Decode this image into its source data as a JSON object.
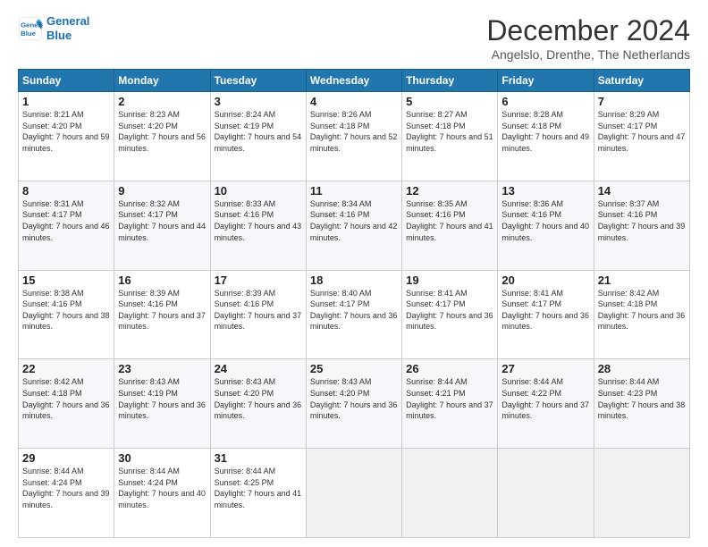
{
  "logo": {
    "line1": "General",
    "line2": "Blue"
  },
  "title": "December 2024",
  "location": "Angelslo, Drenthe, The Netherlands",
  "days_of_week": [
    "Sunday",
    "Monday",
    "Tuesday",
    "Wednesday",
    "Thursday",
    "Friday",
    "Saturday"
  ],
  "weeks": [
    [
      {
        "day": "1",
        "sunrise": "8:21 AM",
        "sunset": "4:20 PM",
        "daylight": "7 hours and 59 minutes."
      },
      {
        "day": "2",
        "sunrise": "8:23 AM",
        "sunset": "4:20 PM",
        "daylight": "7 hours and 56 minutes."
      },
      {
        "day": "3",
        "sunrise": "8:24 AM",
        "sunset": "4:19 PM",
        "daylight": "7 hours and 54 minutes."
      },
      {
        "day": "4",
        "sunrise": "8:26 AM",
        "sunset": "4:18 PM",
        "daylight": "7 hours and 52 minutes."
      },
      {
        "day": "5",
        "sunrise": "8:27 AM",
        "sunset": "4:18 PM",
        "daylight": "7 hours and 51 minutes."
      },
      {
        "day": "6",
        "sunrise": "8:28 AM",
        "sunset": "4:18 PM",
        "daylight": "7 hours and 49 minutes."
      },
      {
        "day": "7",
        "sunrise": "8:29 AM",
        "sunset": "4:17 PM",
        "daylight": "7 hours and 47 minutes."
      }
    ],
    [
      {
        "day": "8",
        "sunrise": "8:31 AM",
        "sunset": "4:17 PM",
        "daylight": "7 hours and 46 minutes."
      },
      {
        "day": "9",
        "sunrise": "8:32 AM",
        "sunset": "4:17 PM",
        "daylight": "7 hours and 44 minutes."
      },
      {
        "day": "10",
        "sunrise": "8:33 AM",
        "sunset": "4:16 PM",
        "daylight": "7 hours and 43 minutes."
      },
      {
        "day": "11",
        "sunrise": "8:34 AM",
        "sunset": "4:16 PM",
        "daylight": "7 hours and 42 minutes."
      },
      {
        "day": "12",
        "sunrise": "8:35 AM",
        "sunset": "4:16 PM",
        "daylight": "7 hours and 41 minutes."
      },
      {
        "day": "13",
        "sunrise": "8:36 AM",
        "sunset": "4:16 PM",
        "daylight": "7 hours and 40 minutes."
      },
      {
        "day": "14",
        "sunrise": "8:37 AM",
        "sunset": "4:16 PM",
        "daylight": "7 hours and 39 minutes."
      }
    ],
    [
      {
        "day": "15",
        "sunrise": "8:38 AM",
        "sunset": "4:16 PM",
        "daylight": "7 hours and 38 minutes."
      },
      {
        "day": "16",
        "sunrise": "8:39 AM",
        "sunset": "4:16 PM",
        "daylight": "7 hours and 37 minutes."
      },
      {
        "day": "17",
        "sunrise": "8:39 AM",
        "sunset": "4:16 PM",
        "daylight": "7 hours and 37 minutes."
      },
      {
        "day": "18",
        "sunrise": "8:40 AM",
        "sunset": "4:17 PM",
        "daylight": "7 hours and 36 minutes."
      },
      {
        "day": "19",
        "sunrise": "8:41 AM",
        "sunset": "4:17 PM",
        "daylight": "7 hours and 36 minutes."
      },
      {
        "day": "20",
        "sunrise": "8:41 AM",
        "sunset": "4:17 PM",
        "daylight": "7 hours and 36 minutes."
      },
      {
        "day": "21",
        "sunrise": "8:42 AM",
        "sunset": "4:18 PM",
        "daylight": "7 hours and 36 minutes."
      }
    ],
    [
      {
        "day": "22",
        "sunrise": "8:42 AM",
        "sunset": "4:18 PM",
        "daylight": "7 hours and 36 minutes."
      },
      {
        "day": "23",
        "sunrise": "8:43 AM",
        "sunset": "4:19 PM",
        "daylight": "7 hours and 36 minutes."
      },
      {
        "day": "24",
        "sunrise": "8:43 AM",
        "sunset": "4:20 PM",
        "daylight": "7 hours and 36 minutes."
      },
      {
        "day": "25",
        "sunrise": "8:43 AM",
        "sunset": "4:20 PM",
        "daylight": "7 hours and 36 minutes."
      },
      {
        "day": "26",
        "sunrise": "8:44 AM",
        "sunset": "4:21 PM",
        "daylight": "7 hours and 37 minutes."
      },
      {
        "day": "27",
        "sunrise": "8:44 AM",
        "sunset": "4:22 PM",
        "daylight": "7 hours and 37 minutes."
      },
      {
        "day": "28",
        "sunrise": "8:44 AM",
        "sunset": "4:23 PM",
        "daylight": "7 hours and 38 minutes."
      }
    ],
    [
      {
        "day": "29",
        "sunrise": "8:44 AM",
        "sunset": "4:24 PM",
        "daylight": "7 hours and 39 minutes."
      },
      {
        "day": "30",
        "sunrise": "8:44 AM",
        "sunset": "4:24 PM",
        "daylight": "7 hours and 40 minutes."
      },
      {
        "day": "31",
        "sunrise": "8:44 AM",
        "sunset": "4:25 PM",
        "daylight": "7 hours and 41 minutes."
      },
      null,
      null,
      null,
      null
    ]
  ],
  "labels": {
    "sunrise": "Sunrise:",
    "sunset": "Sunset:",
    "daylight": "Daylight:"
  }
}
